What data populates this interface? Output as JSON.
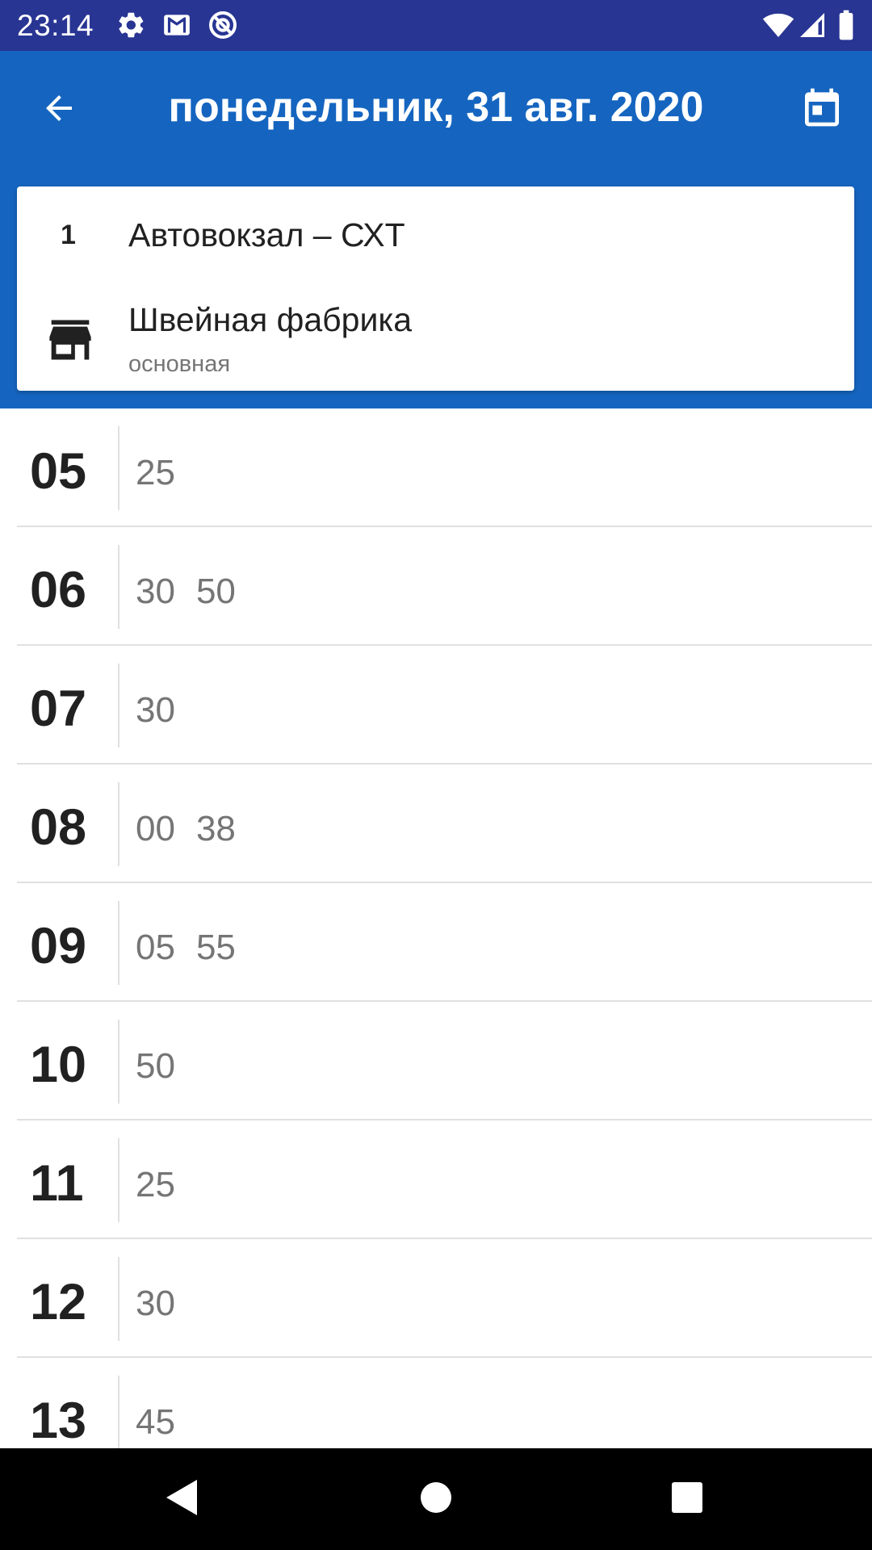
{
  "status_bar": {
    "time": "23:14",
    "icons": [
      "settings-icon",
      "gmail-icon",
      "sync-icon",
      "wifi-icon",
      "signal-icon",
      "battery-icon"
    ]
  },
  "app_bar": {
    "title": "понедельник, 31 авг. 2020",
    "back_icon": "arrow-back-icon",
    "calendar_icon": "calendar-icon",
    "background_color": "#1565C0"
  },
  "route": {
    "number": "1",
    "name": "Автовокзал – СХТ",
    "stop_icon": "store-icon",
    "stop_name": "Швейная фабрика",
    "stop_subtitle": "основная"
  },
  "schedule": [
    {
      "hour": "05",
      "minutes": [
        "25"
      ]
    },
    {
      "hour": "06",
      "minutes": [
        "30",
        "50"
      ]
    },
    {
      "hour": "07",
      "minutes": [
        "30"
      ]
    },
    {
      "hour": "08",
      "minutes": [
        "00",
        "38"
      ]
    },
    {
      "hour": "09",
      "minutes": [
        "05",
        "55"
      ]
    },
    {
      "hour": "10",
      "minutes": [
        "50"
      ]
    },
    {
      "hour": "11",
      "minutes": [
        "25"
      ]
    },
    {
      "hour": "12",
      "minutes": [
        "30"
      ]
    },
    {
      "hour": "13",
      "minutes": [
        "45"
      ]
    }
  ],
  "nav_bar": {
    "icons": [
      "back-triangle-icon",
      "home-circle-icon",
      "recents-square-icon"
    ]
  }
}
